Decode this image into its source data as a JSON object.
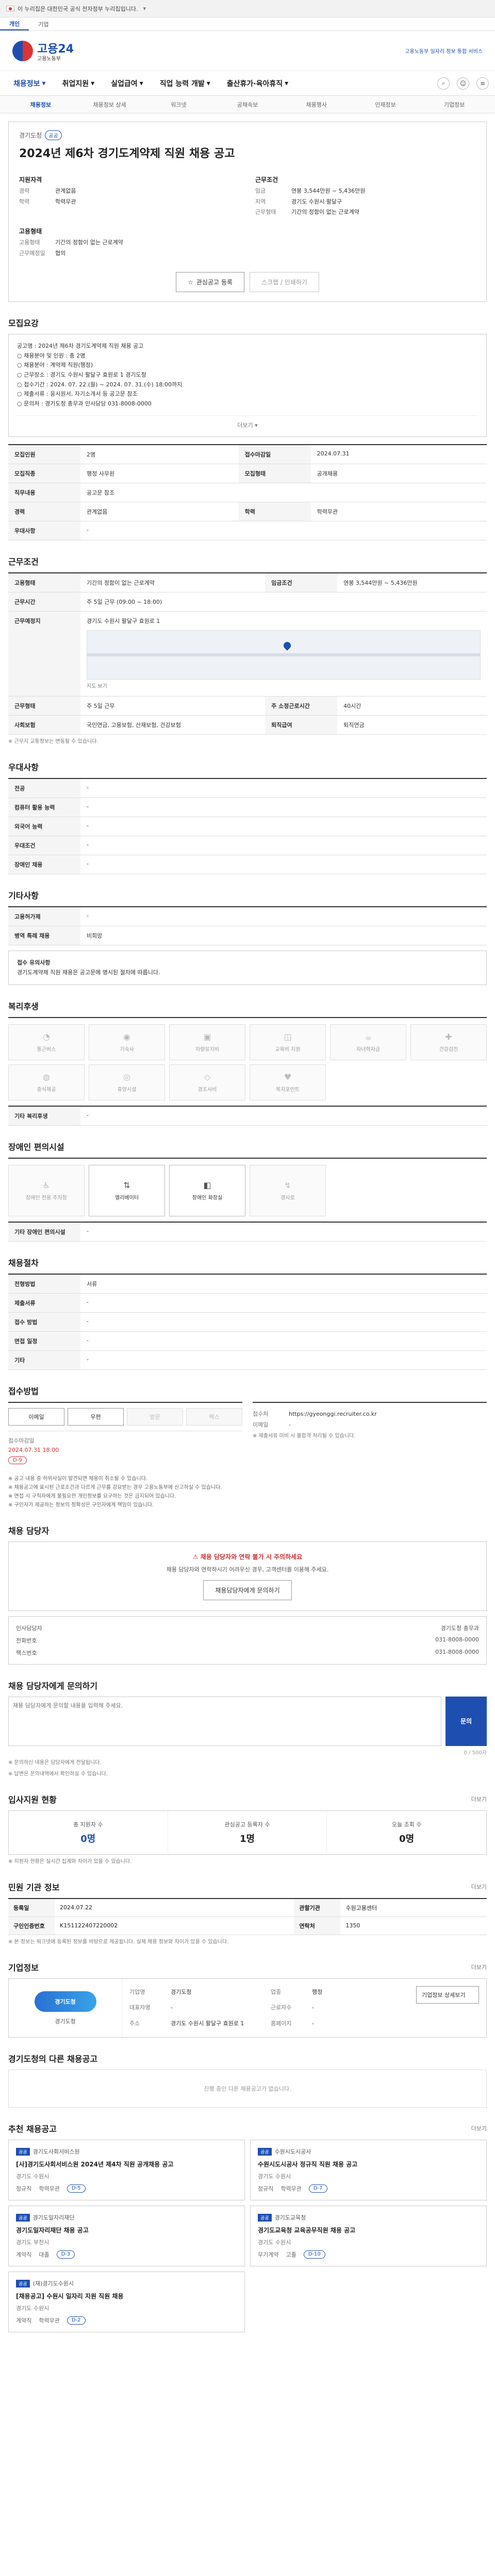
{
  "gov_bar": {
    "text": "이 누리집은 대한민국 공식 전자정부 누리집입니다."
  },
  "tabs": [
    {
      "label": "개인"
    },
    {
      "label": "기업"
    }
  ],
  "tab_notice": "",
  "logo": {
    "name": "고용24",
    "sub": "고용노동부"
  },
  "head_notice": "고용노동부 일자리 정보 통합 서비스",
  "main_nav": [
    {
      "label": "채용정보"
    },
    {
      "label": "취업지원"
    },
    {
      "label": "실업급여"
    },
    {
      "label": "직업 능력 개발"
    },
    {
      "label": "출산휴가·육아휴직"
    }
  ],
  "sub_nav": [
    {
      "label": "채용정보"
    },
    {
      "label": "채용정보 상세"
    },
    {
      "label": "워크넷"
    },
    {
      "label": "공채속보"
    },
    {
      "label": "채용행사"
    },
    {
      "label": "인재정보"
    },
    {
      "label": "기업정보"
    }
  ],
  "hero": {
    "institution": "경기도청",
    "tag": "공공",
    "title": "2024년 제6차 경기도계약제 직원 채용 공고",
    "block_left_title": "지원자격",
    "left_rows": [
      {
        "k": "경력",
        "v": "관계없음"
      },
      {
        "k": "학력",
        "v": "학력무관"
      }
    ],
    "block_right_title": "근무조건",
    "right_rows": [
      {
        "k": "임금",
        "v": "연봉 3,544만원 ~ 5,436만원"
      },
      {
        "k": "지역",
        "v": "경기도 수원시 팔달구"
      },
      {
        "k": "근무형태",
        "v": "기간의 정함이 없는 근로계약"
      }
    ],
    "block_left2_title": "고용형태",
    "left2_rows": [
      {
        "k": "고용형태",
        "v": "기간의 정함이 없는 근로계약"
      },
      {
        "k": "근무예정일",
        "v": "협의"
      }
    ],
    "btn_left": "관심공고 등록",
    "btn_right": "스크랩 / 인쇄하기"
  },
  "sec_recruit": {
    "title": "모집요강",
    "body_lines": [
      "공고명 : 2024년 제6차 경기도계약제 직원 채용 공고",
      "○ 채용분야 및 인원 : 총 2명",
      "○ 채용분야 : 계약제 직원(행정) ",
      "○ 근무장소 : 경기도 수원시 팔달구 효원로 1 경기도청",
      "○ 접수기간 : 2024. 07. 22.(월) ~ 2024. 07. 31.(수) 18:00까지",
      "○ 제출서류 : 응시원서, 자기소개서 등 공고문 참조",
      "○ 문의처 : 경기도청 총무과 인사담당 031-8008-0000"
    ],
    "expand": "더보기"
  },
  "recruit_table": [
    {
      "k": "모집인원",
      "v": "2명",
      "k2": "접수마감일",
      "v2": "2024.07.31"
    },
    {
      "k": "모집직종",
      "v": "행정 사무원",
      "k2": "모집형태",
      "v2": "공개채용"
    },
    {
      "k": "직무내용",
      "v": "공고문 참조",
      "k2": "",
      "v2": ""
    },
    {
      "k": "경력",
      "v": "관계없음",
      "k2": "학력",
      "v2": "학력무관"
    },
    {
      "k": "우대사항",
      "v": "-",
      "k2": "",
      "v2": ""
    }
  ],
  "sec_work": {
    "title": "근무조건"
  },
  "work_table": [
    {
      "k": "고용형태",
      "v": "기간의 정함이 없는 근로계약",
      "k2": "임금조건",
      "v2": "연봉 3,544만원 ~ 5,436만원"
    },
    {
      "k": "근무시간",
      "v": "주 5일 근무 (09:00 ~ 18:00)",
      "k2": "",
      "v2": ""
    },
    {
      "k": "근무예정지",
      "v": "경기도 수원시 팔달구 효원로 1",
      "k2": "",
      "v2": ""
    },
    {
      "k": "근무형태",
      "v": "주 5일 근무",
      "k2": "주 소정근로시간",
      "v2": "40시간"
    },
    {
      "k": "사회보험",
      "v": "국민연금, 고용보험, 산재보험, 건강보험",
      "k2": "퇴직급여",
      "v2": "퇴직연금"
    }
  ],
  "work_map": "지도 보기",
  "work_note": "※ 근무지 교통정보는 변동될 수 있습니다.",
  "sec_qual": {
    "title": "우대사항"
  },
  "qual_table": [
    {
      "k": "전공",
      "v": "-"
    },
    {
      "k": "컴퓨터 활용 능력",
      "v": "-"
    },
    {
      "k": "외국어 능력",
      "v": "-"
    },
    {
      "k": "우대조건",
      "v": "-"
    },
    {
      "k": "장애인 채용",
      "v": "-"
    }
  ],
  "sec_etc": {
    "title": "기타사항"
  },
  "etc_table": [
    {
      "k": "고용허가제",
      "v": "-"
    },
    {
      "k": "병역 특례 채용",
      "v": "비희망"
    }
  ],
  "etc_note_title": "접수 유의사항",
  "etc_note": "경기도계약제 직원 채용은 공고문에 명시된 절차에 따릅니다.",
  "sec_env": {
    "title": "복리후생"
  },
  "env_items": [
    {
      "g": "◔",
      "label": "통근버스"
    },
    {
      "g": "◉",
      "label": "기숙사"
    },
    {
      "g": "▣",
      "label": "차량유지비"
    },
    {
      "g": "◫",
      "label": "교육비 지원"
    },
    {
      "g": "☕",
      "label": "자녀학자금"
    },
    {
      "g": "✚",
      "label": "건강검진"
    },
    {
      "g": "◍",
      "label": "중식제공"
    },
    {
      "g": "◎",
      "label": "휴양시설"
    },
    {
      "g": "◇",
      "label": "경조사비"
    },
    {
      "g": "♥",
      "label": "복지포인트"
    }
  ],
  "env_extra": {
    "k": "기타 복리후생",
    "v": "-"
  },
  "sec_welfare": {
    "title": "장애인 편의시설"
  },
  "welfare_items": [
    {
      "g": "♿",
      "label": "장애인 전용 주차장",
      "on": false
    },
    {
      "g": "⇅",
      "label": "엘리베이터",
      "on": true
    },
    {
      "g": "◧",
      "label": "장애인 화장실",
      "on": true
    },
    {
      "g": "↯",
      "label": "경사로",
      "on": false
    }
  ],
  "welfare_note": {
    "k": "기타 장애인 편의시설",
    "v": "-"
  },
  "sec_process": {
    "title": "채용절차"
  },
  "process_table": [
    {
      "k": "전형방법",
      "v": "서류"
    },
    {
      "k": "제출서류",
      "v": "-"
    },
    {
      "k": "접수 방법",
      "v": "-"
    },
    {
      "k": "면접 일정",
      "v": "-"
    },
    {
      "k": "기타",
      "v": "-"
    }
  ],
  "sec_apply": {
    "title": "접수방법"
  },
  "apply": {
    "method_title": "접수방법",
    "methods": [
      {
        "label": "이메일",
        "off": false
      },
      {
        "label": "우편",
        "off": false
      },
      {
        "label": "방문",
        "off": true
      },
      {
        "label": "팩스",
        "off": true
      }
    ],
    "deadline_label": "접수마감일",
    "deadline_value": "2024.07.31",
    "deadline_time": "18:00",
    "deadline_badge": "D-9",
    "site_label": "접수처",
    "site_value": "https://gyeonggi.recruiter.co.kr",
    "email_label": "이메일",
    "email_value": "-",
    "note": "※ 제출서류 미비 시 불합격 처리될 수 있습니다."
  },
  "apply_warn": [
    "※ 공고 내용 중 허위사실이 발견되면 채용이 취소될 수 있습니다.",
    "※ 채용공고에 표시된 근로조건과 다르게 근무를 강요받는 경우 고용노동부에 신고하실 수 있습니다.",
    "※ 면접 시 구직자에게 불필요한 개인정보를 요구하는 것은 금지되어 있습니다.",
    "※ 구인자가 제공하는 정보의 정확성은 구인자에게 책임이 있습니다."
  ],
  "sec_contact": {
    "title": "채용 담당자"
  },
  "contact": {
    "alert": "채용 담당자와 연락 불가 시 주의하세요",
    "desc": "채용 담당자와 연락하시기 어려우신 경우, 고객센터를 이용해 주세요.",
    "btn": "채용담당자에게 문의하기",
    "name_label": "인사담당자",
    "name_value": "경기도청 총무과",
    "tel_label": "전화번호",
    "tel_value": "031-8008-0000",
    "fax_label": "팩스번호",
    "fax_value": "031-8008-0000"
  },
  "sec_qna": {
    "title": "채용 담당자에게 문의하기"
  },
  "qna": {
    "placeholder": "채용 담당자에게 문의할 내용을 입력해 주세요.",
    "send": "문의",
    "counter": "0 / 500자",
    "note1": "※ 문의하신 내용은 담당자에게 전달됩니다.",
    "note2": "※ 답변은 문의내역에서 확인하실 수 있습니다."
  },
  "sec_stats": {
    "title": "입사지원 현황",
    "more": "더보기"
  },
  "stats": [
    {
      "label": "총 지원자 수",
      "num": "0명",
      "blue": true
    },
    {
      "label": "관심공고 등록자 수",
      "num": "1명",
      "blue": false
    },
    {
      "label": "오늘 조회 수",
      "num": "0명",
      "blue": false
    }
  ],
  "stats_note": "※ 지원자 현황은 실시간 집계와 차이가 있을 수 있습니다.",
  "sec_info": {
    "title": "민원 기관 정보",
    "more": "더보기"
  },
  "info_table": [
    {
      "k": "등록일",
      "v": "2024.07.22",
      "k2": "관할기관",
      "v2": "수원고용센터"
    },
    {
      "k": "구인인증번호",
      "v": "K151122407220002",
      "k2": "연락처",
      "v2": "1350"
    }
  ],
  "info_note": "※ 본 정보는 워크넷에 등록된 정보를 바탕으로 제공됩니다. 실제 채용 정보와 차이가 있을 수 있습니다.",
  "sec_company": {
    "title": "기업정보",
    "more": "더보기"
  },
  "company": {
    "logo_text": "경기도청",
    "logo_caption": "경기도청",
    "rows": [
      {
        "k": "기업명",
        "v": "경기도청"
      },
      {
        "k": "업종",
        "v": "행정"
      },
      {
        "k": "대표자명",
        "v": "-"
      },
      {
        "k": "근로자수",
        "v": "-"
      },
      {
        "k": "주소",
        "v": "경기도 수원시 팔달구 효원로 1"
      },
      {
        "k": "홈페이지",
        "v": "-"
      }
    ],
    "btn": "기업정보 상세보기"
  },
  "sec_similar": {
    "title": "경기도청의 다른 채용공고"
  },
  "similar_empty": "진행 중인 다른 채용공고가 없습니다.",
  "sec_rec": {
    "title": "추천 채용공고",
    "more": "더보기"
  },
  "rec_items": [
    {
      "badge": "공공",
      "org": "경기도사회서비스원",
      "title": "[사]경기도사회서비스원 2024년 제4차 직원 공개채용 공고",
      "meta": "경기도 수원시",
      "m1": "정규직",
      "m2": "학력무관",
      "pill": "D-5"
    },
    {
      "badge": "공공",
      "org": "수원시도시공사",
      "title": "수원시도시공사 정규직 직원 채용 공고",
      "meta": "경기도 수원시",
      "m1": "정규직",
      "m2": "학력무관",
      "pill": "D-7"
    },
    {
      "badge": "공공",
      "org": "경기도일자리재단",
      "title": "경기도일자리재단 채용 공고",
      "meta": "경기도 부천시",
      "m1": "계약직",
      "m2": "대졸",
      "pill": "D-3"
    },
    {
      "badge": "공공",
      "org": "경기도교육청",
      "title": "경기도교육청 교육공무직원 채용 공고",
      "meta": "경기도 수원시",
      "m1": "무기계약",
      "m2": "고졸",
      "pill": "D-10"
    },
    {
      "badge": "공공",
      "org": "(재)경기도수원시",
      "title": "[채용공고] 수원시 일자리 지원 직원 채용",
      "meta": "경기도 수원시",
      "m1": "계약직",
      "m2": "학력무관",
      "pill": "D-2"
    }
  ]
}
